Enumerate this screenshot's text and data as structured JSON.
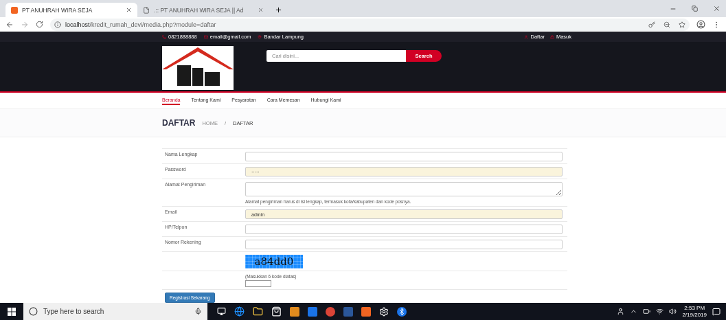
{
  "browser": {
    "tabs": [
      {
        "title": "PT ANUHRAH WIRA SEJA",
        "selected": true,
        "kind": "site"
      },
      {
        "title": ".:: PT ANUHRAH WIRA SEJA || Ad",
        "selected": false,
        "kind": "page"
      }
    ],
    "address": {
      "host": "localhost",
      "path": "/kredit_rumah_devi/media.php?module=daftar"
    }
  },
  "topbar": {
    "phone": "0821888888",
    "email": "email@gmail.com",
    "location": "Bandar Lampung",
    "links": [
      "Daftar",
      "Masuk"
    ]
  },
  "search": {
    "placeholder": "Cari disini...",
    "button": "Search"
  },
  "nav": [
    {
      "label": "Beranda",
      "selected": true
    },
    {
      "label": "Tentang Kami",
      "selected": false
    },
    {
      "label": "Pesyaratan",
      "selected": false
    },
    {
      "label": "Cara Memesan",
      "selected": false
    },
    {
      "label": "Hubungi Kami",
      "selected": false
    }
  ],
  "page": {
    "title": "DAFTAR",
    "breadcrumb": [
      "HOME",
      "DAFTAR"
    ],
    "separator": "/"
  },
  "form": {
    "rows": [
      {
        "kind": "input",
        "label": "Nama Lengkap",
        "value": "",
        "autofilled": false
      },
      {
        "kind": "input",
        "label": "Password",
        "value": "·····",
        "autofilled": true
      },
      {
        "kind": "textarea",
        "label": "Alamat Pengiriman",
        "value": "",
        "hint": "Alamat pengiriman harus di isi lengkap, termasuk kota/kabupaten dan kode posnya."
      },
      {
        "kind": "input",
        "label": "Email",
        "value": "admin",
        "autofilled": true
      },
      {
        "kind": "input",
        "label": "HP/Telpon",
        "value": "",
        "autofilled": false
      },
      {
        "kind": "input",
        "label": "Nomor Rekening",
        "value": "",
        "autofilled": false
      },
      {
        "kind": "captcha",
        "code": "a84dd0"
      },
      {
        "kind": "code",
        "hint": "(Masukkan 6 kode diatas)"
      }
    ],
    "submit": "Registrasi Sekarang"
  },
  "taskbar": {
    "search_placeholder": "Type here to search",
    "time": "2:53 PM",
    "date": "2/19/2019"
  }
}
